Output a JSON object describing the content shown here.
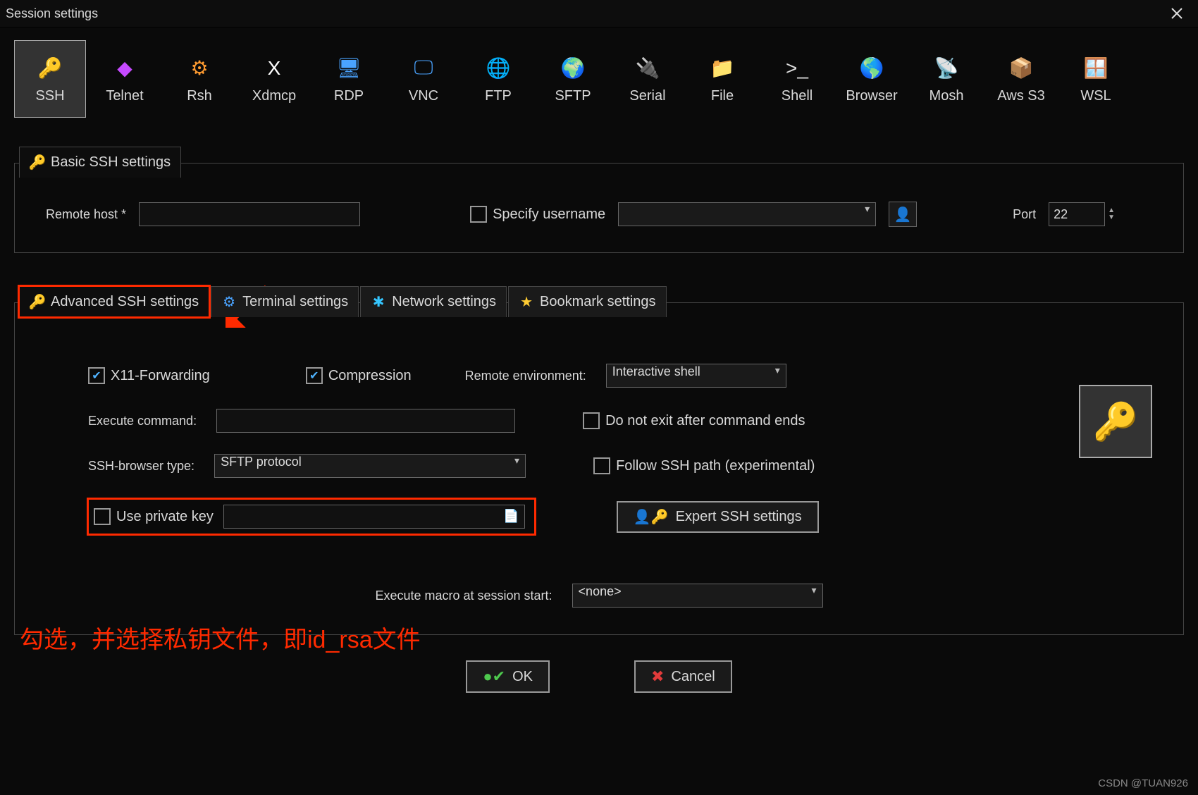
{
  "window": {
    "title": "Session settings"
  },
  "protocols": [
    "SSH",
    "Telnet",
    "Rsh",
    "Xdmcp",
    "RDP",
    "VNC",
    "FTP",
    "SFTP",
    "Serial",
    "File",
    "Shell",
    "Browser",
    "Mosh",
    "Aws S3",
    "WSL"
  ],
  "protocol_selected": "SSH",
  "basic": {
    "tab_label": "Basic SSH settings",
    "remote_host_label": "Remote host *",
    "remote_host_value": "",
    "specify_username_label": "Specify username",
    "specify_username_checked": false,
    "username_value": "",
    "port_label": "Port",
    "port_value": "22"
  },
  "adv_tabs": {
    "advanced": "Advanced SSH settings",
    "terminal": "Terminal settings",
    "network": "Network settings",
    "bookmark": "Bookmark settings",
    "active": "advanced"
  },
  "adv": {
    "x11_label": "X11-Forwarding",
    "x11_checked": true,
    "compression_label": "Compression",
    "compression_checked": true,
    "remote_env_label": "Remote environment:",
    "remote_env_value": "Interactive shell",
    "exec_cmd_label": "Execute command:",
    "exec_cmd_value": "",
    "no_exit_label": "Do not exit after command ends",
    "no_exit_checked": false,
    "sshbrowser_label": "SSH-browser type:",
    "sshbrowser_value": "SFTP protocol",
    "follow_path_label": "Follow SSH path (experimental)",
    "follow_path_checked": false,
    "use_pk_label": "Use private key",
    "use_pk_checked": false,
    "pk_path_value": "",
    "expert_btn": "Expert SSH settings",
    "macro_label": "Execute macro at session start:",
    "macro_value": "<none>"
  },
  "buttons": {
    "ok": "OK",
    "cancel": "Cancel"
  },
  "annotation": "勾选，并选择私钥文件，即id_rsa文件",
  "watermark": "CSDN @TUAN926"
}
